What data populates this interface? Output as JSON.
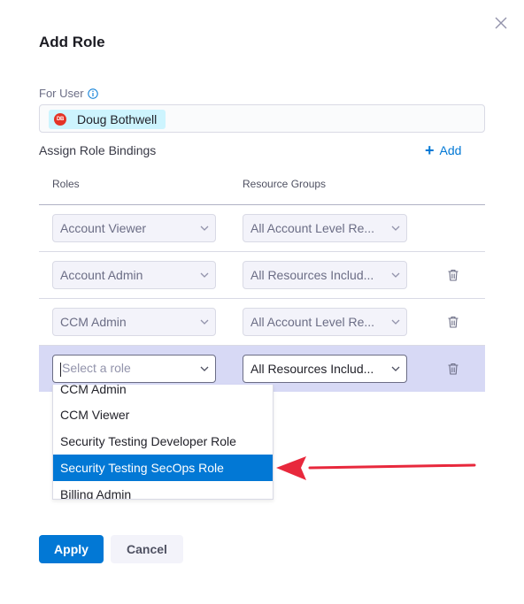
{
  "dialog": {
    "title": "Add Role",
    "for_user_label": "For User",
    "user": {
      "initials": "DB",
      "name": "Doug Bothwell"
    },
    "assign_label": "Assign Role Bindings",
    "add_label": "Add",
    "columns": {
      "roles": "Roles",
      "resource_groups": "Resource Groups"
    },
    "rows": [
      {
        "role": "Account Viewer",
        "resource_group": "All Account Level Re..."
      },
      {
        "role": "Account Admin",
        "resource_group": "All Resources Includ..."
      },
      {
        "role": "CCM Admin",
        "resource_group": "All Account Level Re..."
      },
      {
        "role_placeholder": "Select a role",
        "resource_group": "All Resources Includ..."
      }
    ],
    "role_dropdown": {
      "options": [
        "CCM Admin",
        "CCM Viewer",
        "Security Testing Developer Role",
        "Security Testing SecOps Role",
        "Billing Admin"
      ],
      "highlighted": "Security Testing SecOps Role"
    },
    "apply_label": "Apply",
    "cancel_label": "Cancel"
  },
  "colors": {
    "primary": "#0278d5",
    "active_row": "#d7d9f5",
    "arrow": "#e8283c",
    "avatar": "#e43326",
    "chip": "#cdf4fe"
  },
  "icons": [
    "close-icon",
    "info-icon",
    "plus-icon",
    "chevron-down-icon",
    "trash-icon",
    "arrow-annotation"
  ]
}
